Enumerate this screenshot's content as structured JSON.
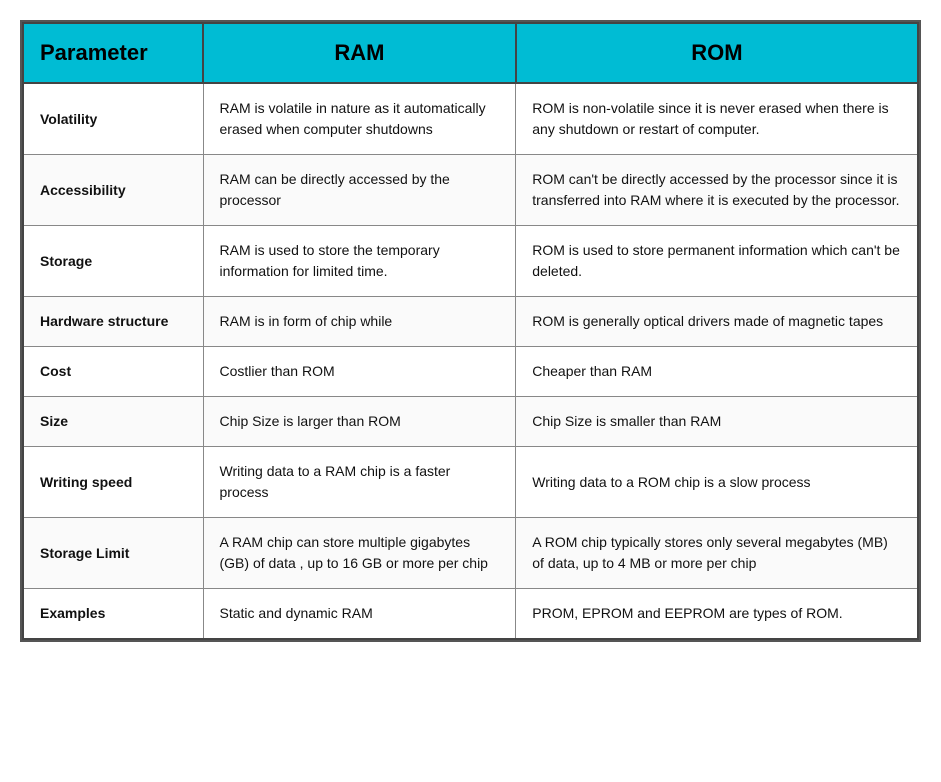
{
  "table": {
    "headers": {
      "parameter": "Parameter",
      "ram": "RAM",
      "rom": "ROM"
    },
    "rows": [
      {
        "parameter": "Volatility",
        "ram": "RAM is volatile in nature as it automatically erased when computer shutdowns",
        "rom": "ROM is non-volatile since it is never erased when there is any shutdown or restart of computer."
      },
      {
        "parameter": "Accessibility",
        "ram": "RAM can be directly accessed by the processor",
        "rom": "ROM can't be directly accessed by the processor since it is transferred into RAM where it is executed by the processor."
      },
      {
        "parameter": "Storage",
        "ram": "RAM is used to store the temporary information for limited time.",
        "rom": "ROM is used to store permanent information which can't be deleted."
      },
      {
        "parameter": "Hardware structure",
        "ram": "RAM is in form of chip while",
        "rom": "ROM is generally optical drivers made of magnetic tapes"
      },
      {
        "parameter": "Cost",
        "ram": "Costlier than ROM",
        "rom": "Cheaper than RAM"
      },
      {
        "parameter": "Size",
        "ram": "Chip Size is larger than ROM",
        "rom": "Chip Size is smaller than RAM"
      },
      {
        "parameter": "Writing speed",
        "ram": "Writing data to a RAM chip is a faster process",
        "rom": "Writing data to a ROM chip is a slow process"
      },
      {
        "parameter": "Storage Limit",
        "ram": "A RAM chip can store multiple gigabytes (GB) of data , up to 16 GB or more per chip",
        "rom": "A ROM chip typically stores only several megabytes (MB) of data, up to 4 MB or more per chip"
      },
      {
        "parameter": "Examples",
        "ram": "Static and dynamic RAM",
        "rom": "PROM, EPROM and EEPROM are types of ROM."
      }
    ]
  }
}
